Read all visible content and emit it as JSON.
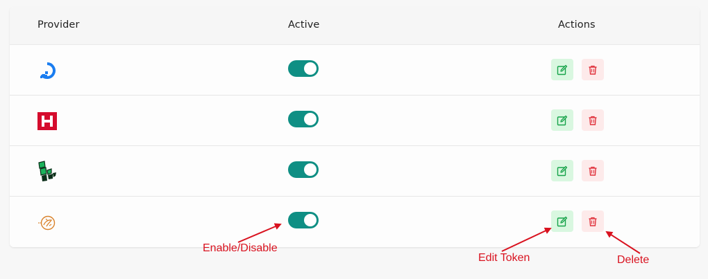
{
  "table": {
    "headers": {
      "provider": "Provider",
      "active": "Active",
      "actions": "Actions"
    },
    "rows": [
      {
        "provider_icon": "digitalocean-icon",
        "active": true
      },
      {
        "provider_icon": "hetzner-icon",
        "active": true
      },
      {
        "provider_icon": "linode-icon",
        "active": true
      },
      {
        "provider_icon": "vultr-sun-icon",
        "active": true
      }
    ]
  },
  "annotations": {
    "enable_disable": "Enable/Disable",
    "edit_token": "Edit Token",
    "delete": "Delete"
  },
  "colors": {
    "toggle_on": "#0f8f84",
    "edit_bg": "#d9f7e0",
    "edit_icon": "#17a34a",
    "delete_bg": "#fdeaea",
    "delete_icon": "#e0313b",
    "annotation": "#d9121f"
  }
}
